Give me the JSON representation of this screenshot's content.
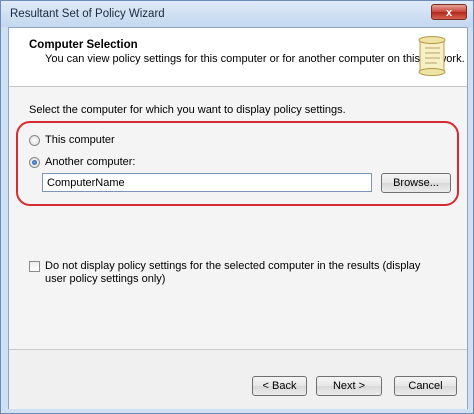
{
  "window": {
    "title": "Resultant Set of Policy Wizard",
    "close_label": "x"
  },
  "header": {
    "title": "Computer Selection",
    "subtitle": "You can view policy settings for this computer or for another computer on this network.",
    "icon": "scroll-icon"
  },
  "body": {
    "instruction": "Select the computer for which you want to display policy settings.",
    "options": [
      {
        "label": "This computer",
        "checked": false
      },
      {
        "label": "Another computer:",
        "checked": true
      }
    ],
    "computer_name_value": "ComputerName",
    "browse_label": "Browse...",
    "checkbox_label": "Do not display policy settings for the selected computer in the results (display user policy settings only)",
    "checkbox_checked": false,
    "highlight_color": "#d62b33"
  },
  "footer": {
    "back_label": "< Back",
    "next_label": "Next >",
    "cancel_label": "Cancel"
  }
}
